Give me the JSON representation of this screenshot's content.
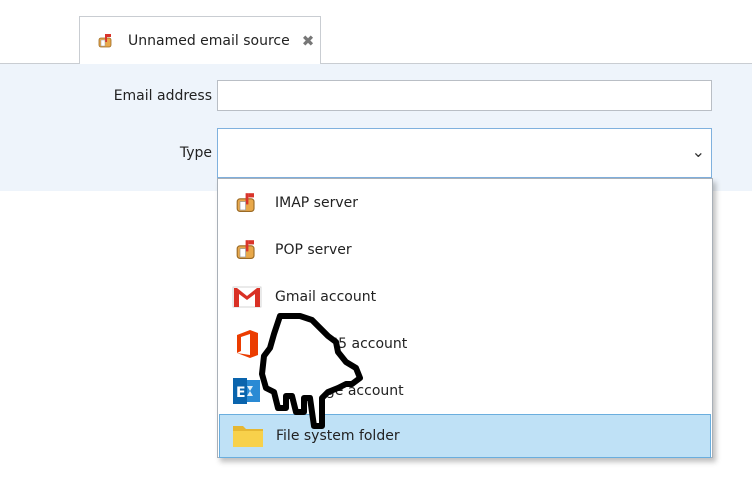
{
  "tab": {
    "title": "Unnamed email source",
    "icon": "mailbox-icon",
    "close_icon": "close-icon"
  },
  "form": {
    "email_label": "Email address",
    "email_value": "",
    "type_label": "Type",
    "type_value": ""
  },
  "dropdown": {
    "options": [
      {
        "label": "IMAP server",
        "icon": "mailbox-icon"
      },
      {
        "label": "POP server",
        "icon": "mailbox-icon"
      },
      {
        "label": "Gmail account",
        "icon": "gmail-icon"
      },
      {
        "label": "Office 365 account",
        "icon": "office-icon"
      },
      {
        "label": "Exchange account",
        "icon": "exchange-icon"
      },
      {
        "label": "File system folder",
        "icon": "folder-icon",
        "selected": true
      }
    ]
  },
  "colors": {
    "panel_bg": "#eef4fb",
    "selected_bg": "#bfe1f6",
    "selected_border": "#6aaede",
    "gmail_red": "#d93025",
    "office_orange": "#eb3c00",
    "exchange_blue": "#0a64ad",
    "folder_yellow": "#f8d14b"
  }
}
